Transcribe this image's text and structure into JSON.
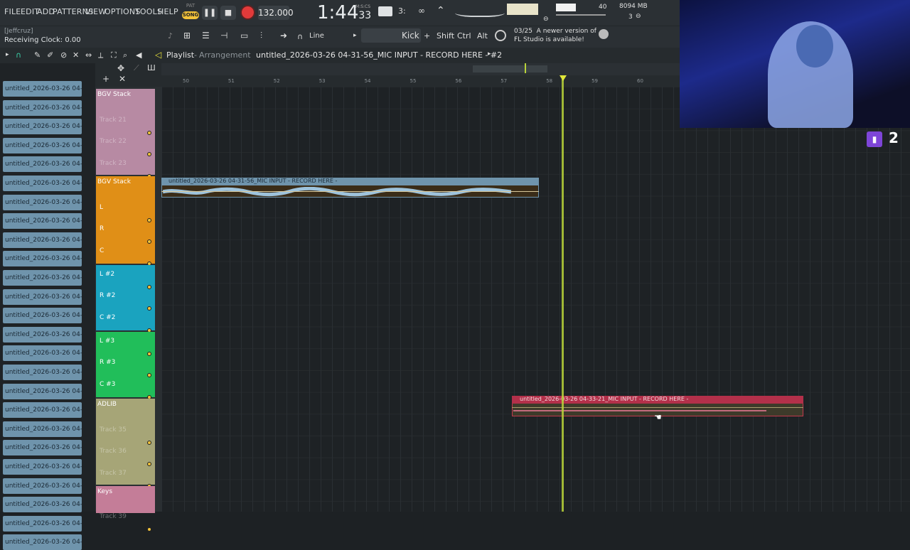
{
  "menu": [
    "FILE",
    "EDIT",
    "ADD",
    "PATTERNS",
    "VIEW",
    "OPTIONS",
    "TOOLS",
    "HELP"
  ],
  "transport": {
    "pat_label": "PAT",
    "song_label": "SONG",
    "tempo": "132.000",
    "clock": "1:44",
    "clock_sub": "33",
    "clock_small": "M:S:CS"
  },
  "meters": {
    "volume": "40",
    "memory": "8094 MB",
    "polyphony": "3"
  },
  "user": "[Jeffcruz]",
  "receiving_clock": "Receiving Clock: 0.00",
  "snap_mode": "Line",
  "channel_name": "Kick",
  "modifiers": [
    "Shift",
    "Ctrl",
    "Alt"
  ],
  "notice": {
    "date": "03/25",
    "line1": "A newer version of",
    "line2": "FL Studio is available!"
  },
  "playlist": {
    "title": "Playlist",
    "view": "Arrangement",
    "file": "untitled_2026-03-26 04-31-56_MIC INPUT - RECORD HERE - #2"
  },
  "browser_clips": [
    "untitled_2026-03-26 04-...",
    "untitled_2026-03-26 04-...",
    "untitled_2026-03-26 04-...",
    "untitled_2026-03-26 04-...",
    "untitled_2026-03-26 04-...",
    "untitled_2026-03-26 04-...",
    "untitled_2026-03-26 04-...",
    "untitled_2026-03-26 04-...",
    "untitled_2026-03-26 04-...",
    "untitled_2026-03-26 04-...",
    "untitled_2026-03-26 04-...",
    "untitled_2026-03-26 04-...",
    "untitled_2026-03-26 04-...",
    "untitled_2026-03-26 04-...",
    "untitled_2026-03-26 04-...",
    "untitled_2026-03-26 04-...",
    "untitled_2026-03-26 04-...",
    "untitled_2026-03-26 04-...",
    "untitled_2026-03-26 04-...",
    "untitled_2026-03-26 04-...",
    "untitled_2026-03-26 04-...",
    "untitled_2026-03-26 04-...",
    "untitled_2026-03-26 04-...",
    "untitled_2026-03-26 04-...",
    "untitled_2026-03-26 04-..."
  ],
  "bar_numbers": [
    "50",
    "51",
    "52",
    "53",
    "54",
    "55",
    "56",
    "57",
    "58",
    "59",
    "60"
  ],
  "tracks": [
    {
      "group": "BGV Stack",
      "color": "#b78aa3",
      "items": [
        "Track 21",
        "Track 22",
        "Track 23"
      ]
    },
    {
      "group": "BGV Stack",
      "color": "#e08f17",
      "items": [
        "L",
        "R",
        "C"
      ]
    },
    {
      "group": "",
      "color": "#1aa3bf",
      "items": [
        "L #2",
        "R #2",
        "C #2"
      ]
    },
    {
      "group": "",
      "color": "#21be5a",
      "items": [
        "L #3",
        "R #3",
        "C #3"
      ]
    },
    {
      "group": "ADLIB",
      "color": "#a6a577",
      "items": [
        "Track 35",
        "Track 36",
        "Track 37"
      ]
    },
    {
      "group": "Keys",
      "color": "#c47d98",
      "items": [
        "Track 39"
      ]
    }
  ],
  "grid_clips": {
    "a": "untitled_2026-03-26 04-31-56_MIC INPUT - RECORD HERE -",
    "b": "untitled_2026-03-26 04-33-21_MIC INPUT - RECORD HERE -"
  },
  "stream": {
    "viewer_count": "2"
  }
}
